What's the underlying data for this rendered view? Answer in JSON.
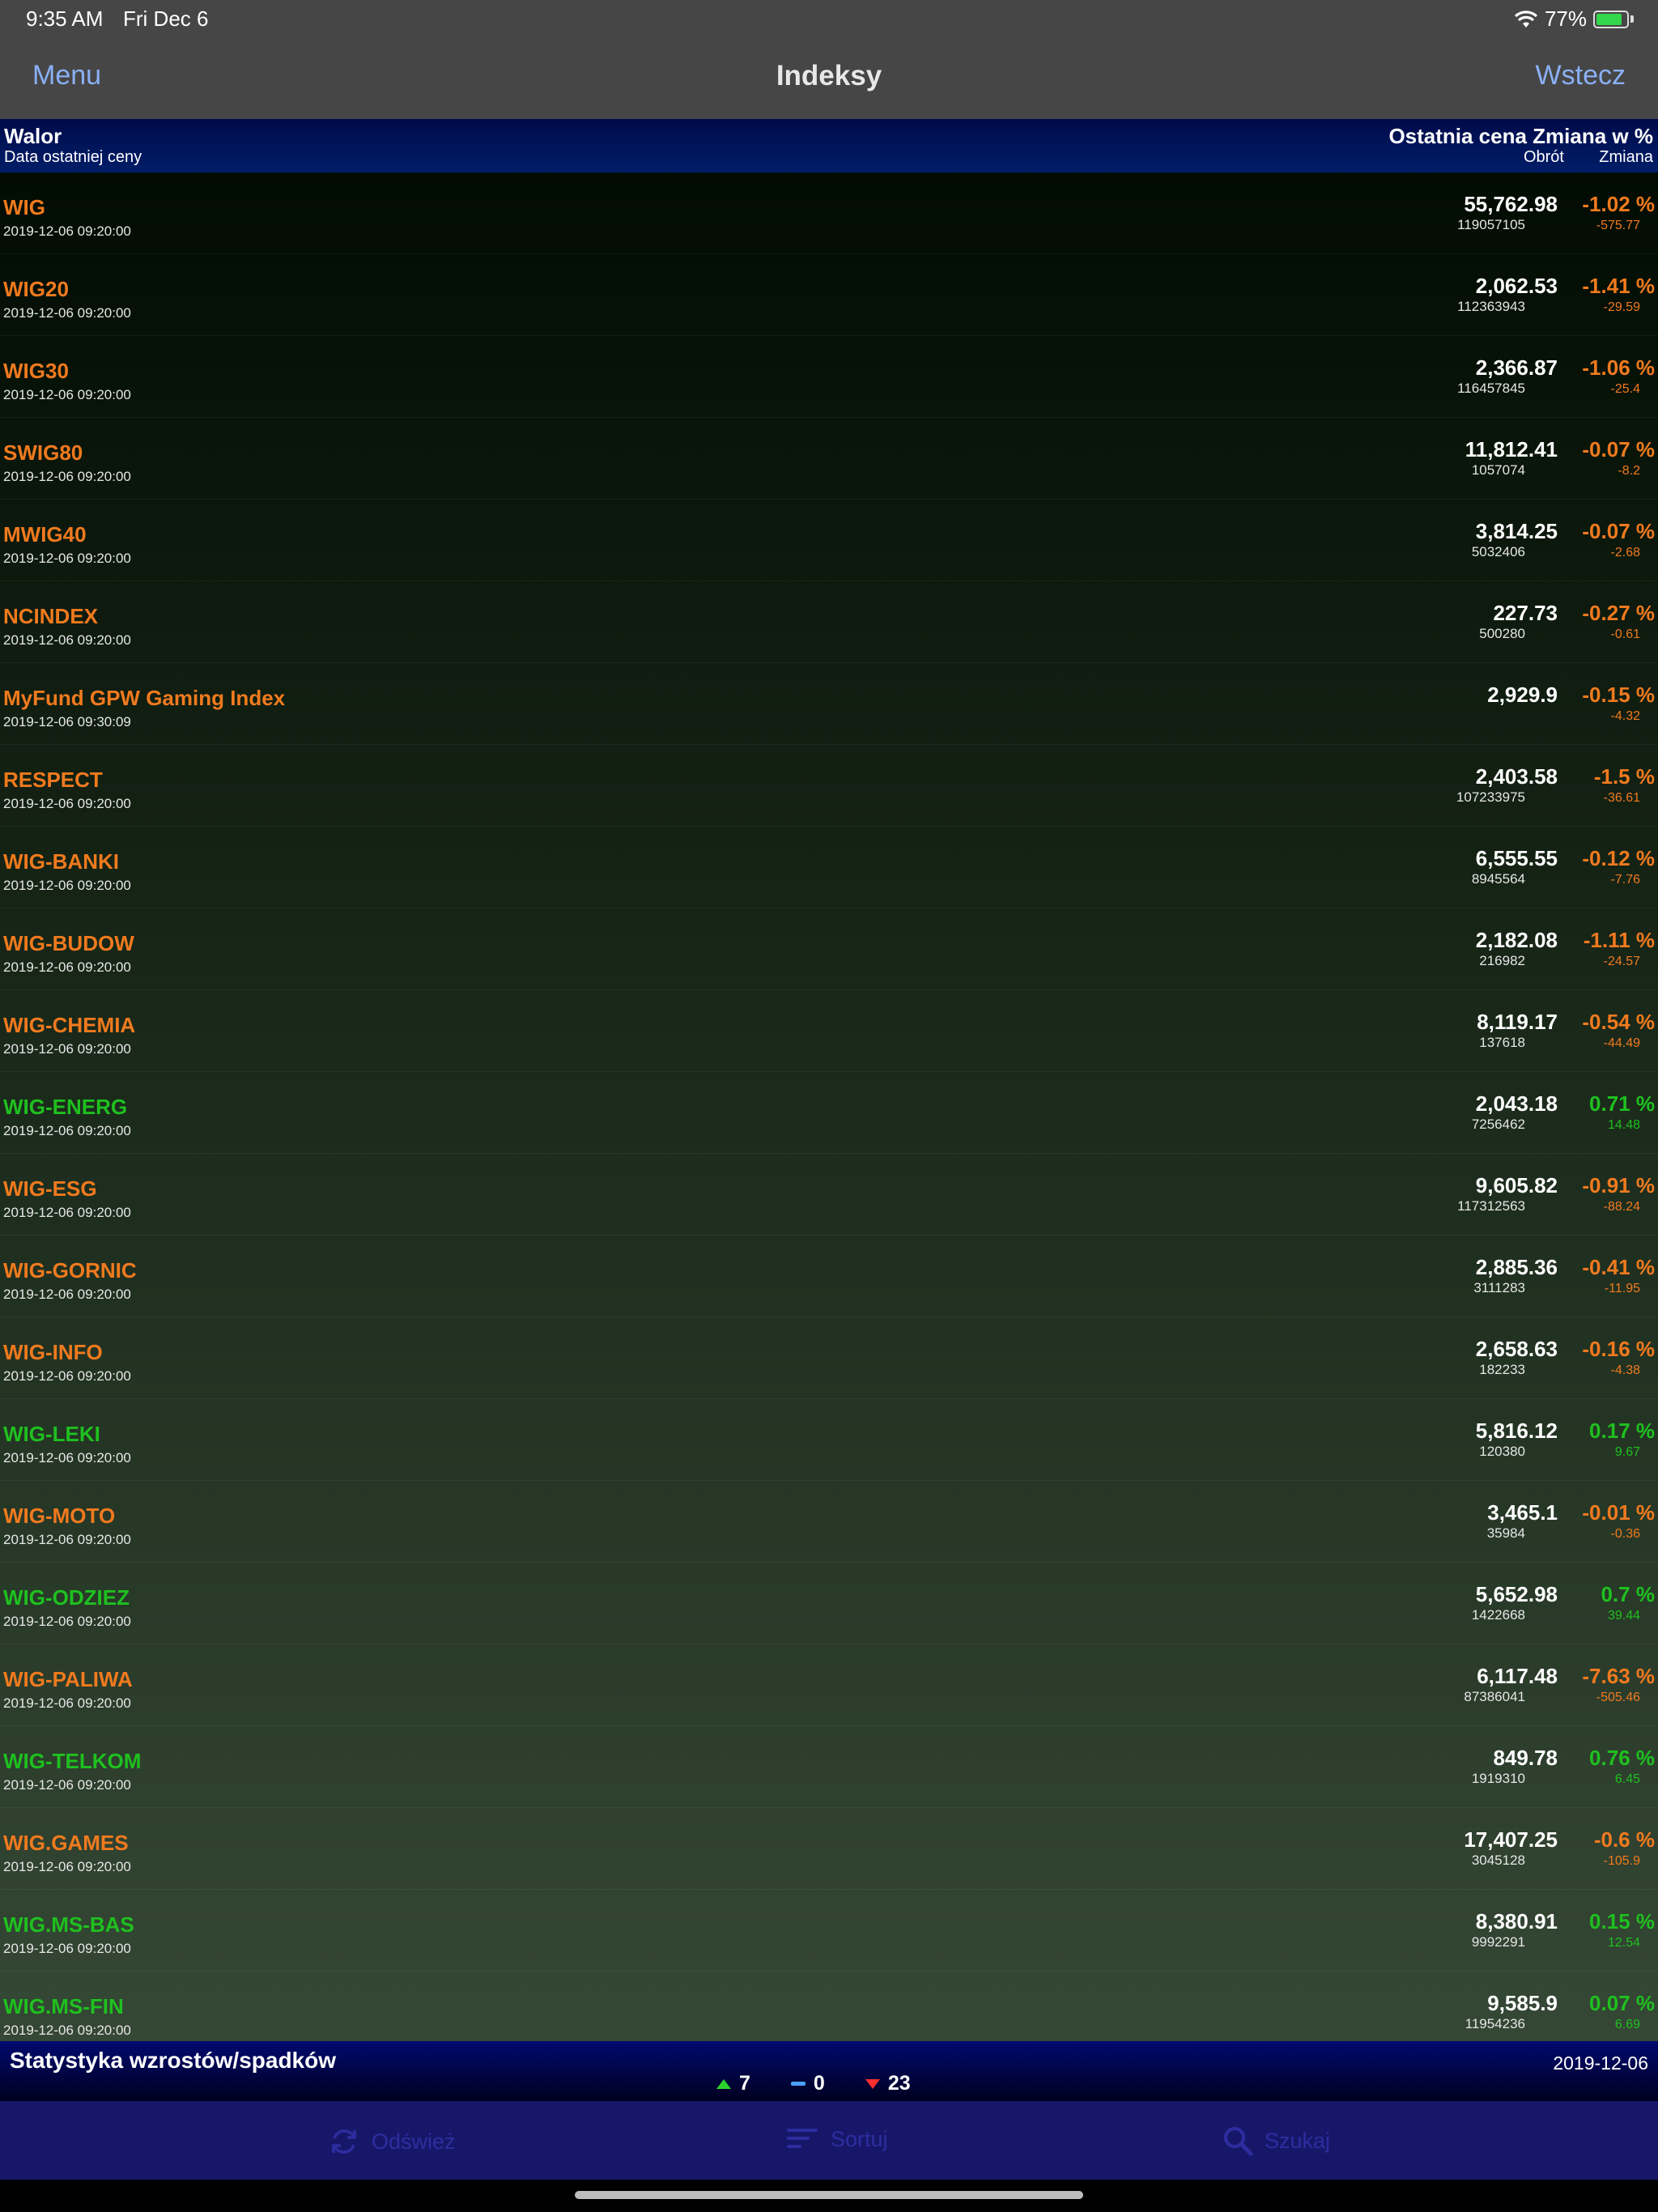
{
  "status_bar": {
    "time": "9:35 AM",
    "date": "Fri Dec 6",
    "battery": "77%"
  },
  "nav": {
    "menu": "Menu",
    "title": "Indeksy",
    "back": "Wstecz"
  },
  "columns": {
    "left_top": "Walor",
    "left_bottom": "Data ostatniej ceny",
    "right_top": "Ostatnia cena Zmiana w %",
    "turnover": "Obrót",
    "change": "Zmiana"
  },
  "rows": [
    {
      "name": "WIG",
      "date": "2019-12-06 09:20:00",
      "price": "55,762.98",
      "turnover": "119057105",
      "pct": "-1.02 %",
      "change": "-575.77",
      "dir": "neg"
    },
    {
      "name": "WIG20",
      "date": "2019-12-06 09:20:00",
      "price": "2,062.53",
      "turnover": "112363943",
      "pct": "-1.41 %",
      "change": "-29.59",
      "dir": "neg"
    },
    {
      "name": "WIG30",
      "date": "2019-12-06 09:20:00",
      "price": "2,366.87",
      "turnover": "116457845",
      "pct": "-1.06 %",
      "change": "-25.4",
      "dir": "neg"
    },
    {
      "name": "SWIG80",
      "date": "2019-12-06 09:20:00",
      "price": "11,812.41",
      "turnover": "1057074",
      "pct": "-0.07 %",
      "change": "-8.2",
      "dir": "neg"
    },
    {
      "name": "MWIG40",
      "date": "2019-12-06 09:20:00",
      "price": "3,814.25",
      "turnover": "5032406",
      "pct": "-0.07 %",
      "change": "-2.68",
      "dir": "neg"
    },
    {
      "name": "NCINDEX",
      "date": "2019-12-06 09:20:00",
      "price": "227.73",
      "turnover": "500280",
      "pct": "-0.27 %",
      "change": "-0.61",
      "dir": "neg"
    },
    {
      "name": "MyFund GPW Gaming Index",
      "date": "2019-12-06 09:30:09",
      "price": "2,929.9",
      "turnover": "",
      "pct": "-0.15 %",
      "change": "-4.32",
      "dir": "neg"
    },
    {
      "name": "RESPECT",
      "date": "2019-12-06 09:20:00",
      "price": "2,403.58",
      "turnover": "107233975",
      "pct": "-1.5 %",
      "change": "-36.61",
      "dir": "neg"
    },
    {
      "name": "WIG-BANKI",
      "date": "2019-12-06 09:20:00",
      "price": "6,555.55",
      "turnover": "8945564",
      "pct": "-0.12 %",
      "change": "-7.76",
      "dir": "neg"
    },
    {
      "name": "WIG-BUDOW",
      "date": "2019-12-06 09:20:00",
      "price": "2,182.08",
      "turnover": "216982",
      "pct": "-1.11 %",
      "change": "-24.57",
      "dir": "neg"
    },
    {
      "name": "WIG-CHEMIA",
      "date": "2019-12-06 09:20:00",
      "price": "8,119.17",
      "turnover": "137618",
      "pct": "-0.54 %",
      "change": "-44.49",
      "dir": "neg"
    },
    {
      "name": "WIG-ENERG",
      "date": "2019-12-06 09:20:00",
      "price": "2,043.18",
      "turnover": "7256462",
      "pct": "0.71 %",
      "change": "14.48",
      "dir": "pos"
    },
    {
      "name": "WIG-ESG",
      "date": "2019-12-06 09:20:00",
      "price": "9,605.82",
      "turnover": "117312563",
      "pct": "-0.91 %",
      "change": "-88.24",
      "dir": "neg"
    },
    {
      "name": "WIG-GORNIC",
      "date": "2019-12-06 09:20:00",
      "price": "2,885.36",
      "turnover": "3111283",
      "pct": "-0.41 %",
      "change": "-11.95",
      "dir": "neg"
    },
    {
      "name": "WIG-INFO",
      "date": "2019-12-06 09:20:00",
      "price": "2,658.63",
      "turnover": "182233",
      "pct": "-0.16 %",
      "change": "-4.38",
      "dir": "neg"
    },
    {
      "name": "WIG-LEKI",
      "date": "2019-12-06 09:20:00",
      "price": "5,816.12",
      "turnover": "120380",
      "pct": "0.17 %",
      "change": "9.67",
      "dir": "pos"
    },
    {
      "name": "WIG-MOTO",
      "date": "2019-12-06 09:20:00",
      "price": "3,465.1",
      "turnover": "35984",
      "pct": "-0.01 %",
      "change": "-0.36",
      "dir": "neg"
    },
    {
      "name": "WIG-ODZIEZ",
      "date": "2019-12-06 09:20:00",
      "price": "5,652.98",
      "turnover": "1422668",
      "pct": "0.7 %",
      "change": "39.44",
      "dir": "pos"
    },
    {
      "name": "WIG-PALIWA",
      "date": "2019-12-06 09:20:00",
      "price": "6,117.48",
      "turnover": "87386041",
      "pct": "-7.63 %",
      "change": "-505.46",
      "dir": "neg"
    },
    {
      "name": "WIG-TELKOM",
      "date": "2019-12-06 09:20:00",
      "price": "849.78",
      "turnover": "1919310",
      "pct": "0.76 %",
      "change": "6.45",
      "dir": "pos"
    },
    {
      "name": "WIG.GAMES",
      "date": "2019-12-06 09:20:00",
      "price": "17,407.25",
      "turnover": "3045128",
      "pct": "-0.6 %",
      "change": "-105.9",
      "dir": "neg"
    },
    {
      "name": "WIG.MS-BAS",
      "date": "2019-12-06 09:20:00",
      "price": "8,380.91",
      "turnover": "9992291",
      "pct": "0.15 %",
      "change": "12.54",
      "dir": "pos"
    },
    {
      "name": "WIG.MS-FIN",
      "date": "2019-12-06 09:20:00",
      "price": "9,585.9",
      "turnover": "11954236",
      "pct": "0.07 %",
      "change": "6.69",
      "dir": "pos"
    }
  ],
  "stats": {
    "label": "Statystyka wzrostów/spadków",
    "up": "7",
    "flat": "0",
    "down": "23",
    "date": "2019-12-06"
  },
  "tabbar": {
    "refresh": "Odśwież",
    "sort": "Sortuj",
    "search": "Szukaj"
  },
  "colors": {
    "negative": "#f07a1e",
    "positive": "#1fc01f",
    "link": "#8ab0f5"
  }
}
